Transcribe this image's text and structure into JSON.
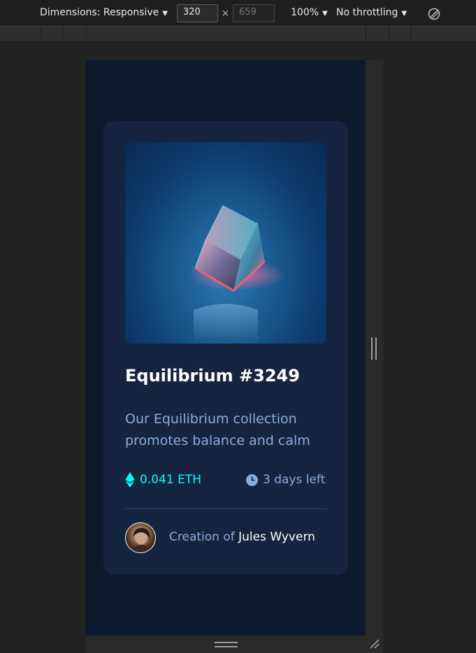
{
  "devtools": {
    "dimensions_label": "Dimensions: Responsive",
    "width_value": "320",
    "height_value": "659",
    "times_symbol": "×",
    "zoom_label": "100%",
    "throttle_label": "No throttling",
    "caret": "▼",
    "icons": {
      "rotate": "rotate-icon",
      "side_resize": "resize-handle-icon",
      "bottom_resize": "resize-handle-icon",
      "corner_resize": "corner-resize-icon"
    }
  },
  "card": {
    "image_alt": "Equilibrium",
    "title": "Equilibrium #3249",
    "description": "Our Equilibrium collection promotes balance and calm",
    "price": "0.041 ETH",
    "price_icon": "ethereum-icon",
    "time_left": "3 days left",
    "time_icon": "clock-icon",
    "creator_prefix": "Creation of",
    "creator_name": "Jules Wyvern"
  },
  "colors": {
    "page_bg": "#0d192c",
    "card_bg": "#15253f",
    "cyan": "#00fff8",
    "soft_blue": "#8bacd9",
    "white": "#ffffff"
  }
}
